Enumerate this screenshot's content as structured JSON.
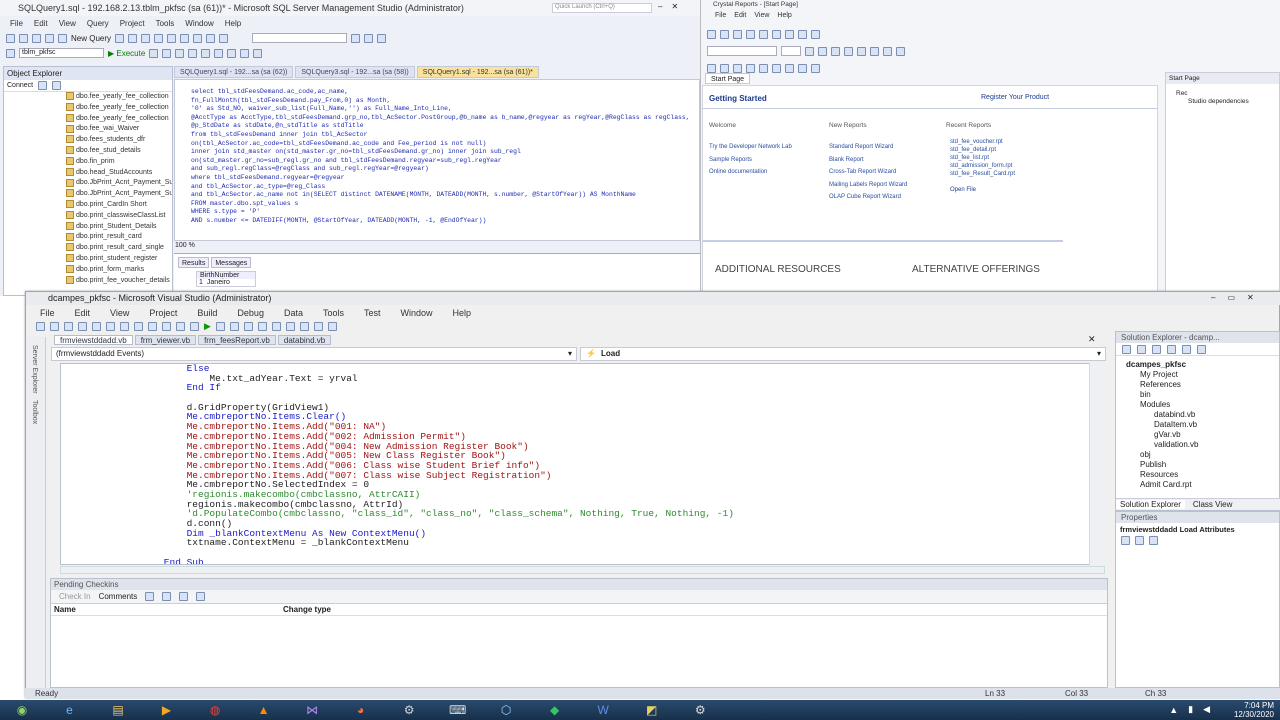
{
  "ssms": {
    "title": "SQLQuery1.sql - 192.168.2.13.tblm_pkfsc (sa (61))* - Microsoft SQL Server Management Studio (Administrator)",
    "quick_launch": "Quick Launch (Ctrl+Q)",
    "menu": [
      "File",
      "Edit",
      "View",
      "Query",
      "Project",
      "Tools",
      "Window",
      "Help"
    ],
    "new_query": "New Query",
    "db_select": "tblm_pkfsc",
    "execute": "Execute",
    "object_explorer": {
      "title": "Object Explorer",
      "connect": "Connect",
      "items": [
        "dbo.fee_yearly_fee_collection",
        "dbo.fee_yearly_fee_collection",
        "dbo.fee_yearly_fee_collection",
        "dbo.fee_wai_Waiver",
        "dbo.fees_students_dfr",
        "dbo.fee_stud_details",
        "dbo.fin_prim",
        "dbo.head_StudAccounts",
        "dbo.JbPrint_Acnt_Payment_Summary",
        "dbo.JbPrint_Acnt_Payment_Summary",
        "dbo.print_CardIn Short",
        "dbo.print_classwiseClassList",
        "dbo.print_Student_Details",
        "dbo.print_result_card",
        "dbo.print_result_card_single",
        "dbo.print_student_register",
        "dbo.print_form_marks",
        "dbo.print_fee_voucher_details"
      ]
    },
    "tabs": [
      "SQLQuery1.sql - 192...sa (sa (62))",
      "SQLQuery3.sql - 192...sa (sa (58))",
      "SQLQuery1.sql - 192...sa (sa (61))*"
    ],
    "sql": [
      "select tbl_stdFeesDemand.ac_code,ac_name,",
      "fn_FullMonth(tbl_stdFeesDemand.pay_From,0) as Month,",
      "'0' as Std_NO, waiver_sub_list(Full_Name,'') as Full_Name_Into_Line,",
      "@AcctType as AcctType,tbl_stdFeesDemand.grp_no,tbl_AcSector.PostGroup,@b_name as b_name,@regyear as regYear,@RegClass as regClass,",
      "@p_StdDate as stdDate,@n_stdTitle as stdTitle",
      "from tbl_stdFeesDemand inner join tbl_AcSector",
      "on(tbl_AcSector.ac_code=tbl_stdFeesDemand.ac_code and Fee_period is not null)",
      "inner join std_master on(std_master.gr_no=tbl_stdFeesDemand.gr_no) inner join sub_regl",
      "on(std_master.gr_no=sub_regl.gr_no and tbl_stdFeesDemand.regyear=sub_regl.regYear",
      "and sub_regl.regClass=@regClass and sub_regl.regYear=@regyear)",
      "where tbl_stdFeesDemand.regyear=@regyear",
      "and tbl_AcSector.ac_type=@reg_Class",
      "and tbl_AcSector.ac_name not in(SELECT distinct DATENAME(MONTH, DATEADD(MONTH, s.number, @StartOfYear)) AS MonthName",
      "FROM master.dbo.spt_values s",
      "WHERE s.type = 'P'",
      "AND s.number <= DATEDIFF(MONTH, @StartOfYear, DATEADD(MONTH, -1, @EndOfYear))"
    ],
    "zoom": "100 %",
    "results_tabs": [
      "Results",
      "Messages"
    ],
    "result_cols": [
      "BirthNumber"
    ],
    "result_rows": [
      "1",
      "Janeiro"
    ]
  },
  "crystal": {
    "title": "Crystal Reports - [Start Page]",
    "menu": [
      "File",
      "Edit",
      "View",
      "Help"
    ],
    "start_tab": "Start Page",
    "getting_started": "Getting Started",
    "register": "Register Your Product",
    "sections": [
      "Welcome",
      "New Reports",
      "Recent Reports"
    ],
    "welcome_links": [
      "Try the Developer Network Lab",
      "Sample Reports",
      "Online documentation"
    ],
    "new_links": [
      "Standard Report Wizard",
      "Blank Report",
      "Cross-Tab Report Wizard",
      "Mailing Labels Report Wizard",
      "OLAP Cube Report Wizard"
    ],
    "recent_links": [
      "std_fee_voucher.rpt",
      "std_fee_detail.rpt",
      "std_fee_list.rpt",
      "std_admission_form.rpt",
      "std_fee_Result_Card.rpt",
      "Open File"
    ],
    "additional": "ADDITIONAL RESOURCES",
    "alternative": "ALTERNATIVE OFFERINGS",
    "side_title": "Start Page",
    "side_items": [
      "Rec",
      "Studio dependencies"
    ]
  },
  "vs": {
    "title": "dcampes_pkfsc - Microsoft Visual Studio (Administrator)",
    "menu": [
      "File",
      "Edit",
      "View",
      "Project",
      "Build",
      "Debug",
      "Data",
      "Tools",
      "Test",
      "Window",
      "Help"
    ],
    "tabs": [
      "frmviewstddadd.vb",
      "frm_viewer.vb",
      "frm_feesReport.vb",
      "databind.vb"
    ],
    "class_combo": "(frmviewstddadd Events)",
    "method_combo": "Load",
    "code": [
      {
        "t": "        Else",
        "c": "k"
      },
      {
        "t": "            Me.txt_adYear.Text = yrval",
        "c": "p"
      },
      {
        "t": "        End If",
        "c": "k"
      },
      {
        "t": "",
        "c": "p"
      },
      {
        "t": "        d.GridProperty(GridView1)",
        "c": "p"
      },
      {
        "t": "        Me.cmbreportNo.Items.Clear()",
        "c": "k"
      },
      {
        "t": "        Me.cmbreportNo.Items.Add(\"001: NA\")",
        "c": "s"
      },
      {
        "t": "        Me.cmbreportNo.Items.Add(\"002: Admission Permit\")",
        "c": "s"
      },
      {
        "t": "        Me.cmbreportNo.Items.Add(\"004: New Admission Register Book\")",
        "c": "s"
      },
      {
        "t": "        Me.cmbreportNo.Items.Add(\"005: New Class Register Book\")",
        "c": "s"
      },
      {
        "t": "        Me.cmbreportNo.Items.Add(\"006: Class wise Student Brief info\")",
        "c": "s"
      },
      {
        "t": "        Me.cmbreportNo.Items.Add(\"007: Class wise Subject Registration\")",
        "c": "s"
      },
      {
        "t": "        Me.cmbreportNo.SelectedIndex = 0",
        "c": "p"
      },
      {
        "t": "        'regionis.makecombo(cmbclassno, AttrCAII)",
        "c": "c"
      },
      {
        "t": "        regionis.makecombo(cmbclassno, AttrId)",
        "c": "p"
      },
      {
        "t": "        'd.PopulateCombo(cmbclassno, \"class_id\", \"class_no\", \"class_schema\", Nothing, True, Nothing, -1)",
        "c": "c"
      },
      {
        "t": "        d.conn()",
        "c": "p"
      },
      {
        "t": "        Dim _blankContextMenu As New ContextMenu()",
        "c": "k"
      },
      {
        "t": "        txtname.ContextMenu = _blankContextMenu",
        "c": "p"
      },
      {
        "t": "",
        "c": "p"
      },
      {
        "t": "    End Sub",
        "c": "k"
      }
    ],
    "pending": {
      "title": "Pending Checkins",
      "check_in": "Check In",
      "comments": "Comments",
      "col_name": "Name",
      "col_change": "Change type"
    },
    "solution": {
      "title": "Solution Explorer - dcamp...",
      "items": [
        {
          "t": "dcampes_pkfsc",
          "b": true,
          "i": 0
        },
        {
          "t": "My Project",
          "i": 1
        },
        {
          "t": "References",
          "i": 1
        },
        {
          "t": "bin",
          "i": 1
        },
        {
          "t": "Modules",
          "i": 1
        },
        {
          "t": "databind.vb",
          "i": 2
        },
        {
          "t": "DataItem.vb",
          "i": 2
        },
        {
          "t": "gVar.vb",
          "i": 2
        },
        {
          "t": "validation.vb",
          "i": 2
        },
        {
          "t": "obj",
          "i": 1
        },
        {
          "t": "Publish",
          "i": 1
        },
        {
          "t": "Resources",
          "i": 1
        },
        {
          "t": "Admit Card.rpt",
          "i": 1
        }
      ],
      "tabs": [
        "Solution Explorer",
        "Class View"
      ]
    },
    "properties": {
      "title": "Properties",
      "object": "frmviewstddadd Load Attributes"
    },
    "status": {
      "ready": "Ready",
      "ln": "Ln 33",
      "col": "Col 33",
      "ch": "Ch 33"
    }
  },
  "taskbar": {
    "time": "7:04 PM",
    "date": "12/30/2020"
  }
}
